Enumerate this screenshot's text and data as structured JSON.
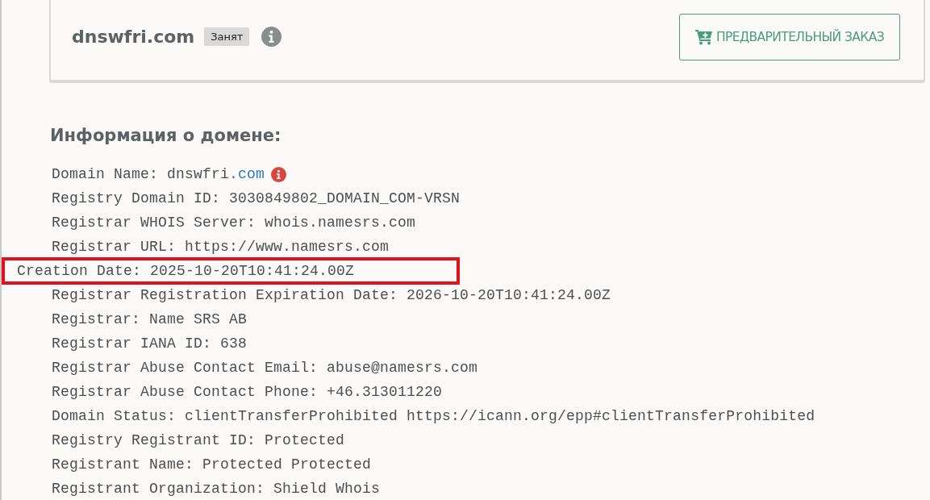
{
  "domain": {
    "name": "dnswfri.com",
    "status": "Занят"
  },
  "preorder_button": {
    "label": "ПРЕДВАРИТЕЛЬНЫЙ ЗАКАЗ"
  },
  "section_title": "Информация о домене:",
  "whois_lines": [
    {
      "kind": "domain",
      "text": "Domain Name: dnswfri",
      "suffix": ".com",
      "highlighted": false
    },
    {
      "kind": "plain",
      "text": "Registry Domain ID: 3030849802_DOMAIN_COM-VRSN",
      "highlighted": false
    },
    {
      "kind": "plain",
      "text": "Registrar WHOIS Server: whois.namesrs.com",
      "highlighted": false
    },
    {
      "kind": "plain",
      "text": "Registrar URL: https://www.namesrs.com",
      "highlighted": false
    },
    {
      "kind": "plain",
      "text": "Creation Date: 2025-10-20T10:41:24.00Z",
      "highlighted": true
    },
    {
      "kind": "plain",
      "text": "Registrar Registration Expiration Date: 2026-10-20T10:41:24.00Z",
      "highlighted": false
    },
    {
      "kind": "plain",
      "text": "Registrar: Name SRS AB",
      "highlighted": false
    },
    {
      "kind": "plain",
      "text": "Registrar IANA ID: 638",
      "highlighted": false
    },
    {
      "kind": "plain",
      "text": "Registrar Abuse Contact Email: abuse@namesrs.com",
      "highlighted": false
    },
    {
      "kind": "plain",
      "text": "Registrar Abuse Contact Phone: +46.313011220",
      "highlighted": false
    },
    {
      "kind": "plain",
      "text": "Domain Status: clientTransferProhibited https://icann.org/epp#clientTransferProhibited",
      "highlighted": false
    },
    {
      "kind": "plain",
      "text": "Registry Registrant ID: Protected",
      "highlighted": false
    },
    {
      "kind": "plain",
      "text": "Registrant Name: Protected Protected",
      "highlighted": false
    },
    {
      "kind": "plain",
      "text": "Registrant Organization: Shield Whois",
      "highlighted": false
    }
  ]
}
